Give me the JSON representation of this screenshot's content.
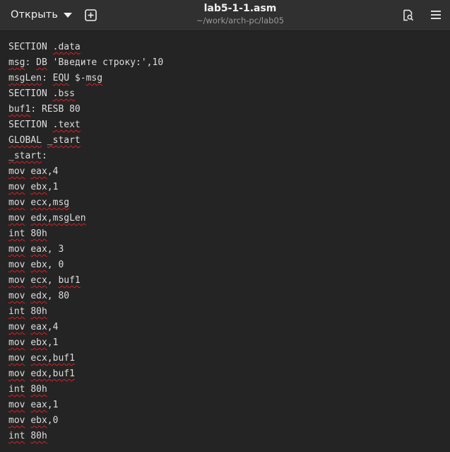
{
  "header": {
    "open_label": "Открыть",
    "title": "lab5-1-1.asm",
    "subtitle": "~/work/arch-pc/lab05"
  },
  "icons": {
    "open_dropdown": "chevron-down-icon",
    "new_tab": "new-tab-icon",
    "search": "document-search-icon",
    "menu": "hamburger-menu-icon"
  },
  "colors": {
    "headerbar": "#303030",
    "editor_bg": "#242424",
    "text": "#dedede",
    "spellcheck_underline": "#e01b24"
  },
  "editor": {
    "lines": [
      [
        {
          "t": "SECTION",
          "s": false
        },
        {
          "t": " ",
          "s": false
        },
        {
          "t": ".data",
          "s": true
        }
      ],
      [
        {
          "t": "msg",
          "s": true
        },
        {
          "t": ": ",
          "s": false
        },
        {
          "t": "DB",
          "s": true
        },
        {
          "t": " 'Введите строку:',10",
          "s": false
        }
      ],
      [
        {
          "t": "msgLen",
          "s": true
        },
        {
          "t": ": ",
          "s": false
        },
        {
          "t": "EQU",
          "s": true
        },
        {
          "t": " $-",
          "s": false
        },
        {
          "t": "msg",
          "s": true
        }
      ],
      [
        {
          "t": "SECTION",
          "s": false
        },
        {
          "t": " ",
          "s": false
        },
        {
          "t": ".bss",
          "s": true
        }
      ],
      [
        {
          "t": "buf1",
          "s": true
        },
        {
          "t": ": ",
          "s": false
        },
        {
          "t": "RESB",
          "s": false
        },
        {
          "t": " 80",
          "s": false
        }
      ],
      [
        {
          "t": "SECTION",
          "s": false
        },
        {
          "t": " ",
          "s": false
        },
        {
          "t": ".text",
          "s": true
        }
      ],
      [
        {
          "t": "GLOBAL",
          "s": true
        },
        {
          "t": " ",
          "s": false
        },
        {
          "t": "_start",
          "s": true
        }
      ],
      [
        {
          "t": "_start",
          "s": true
        },
        {
          "t": ":",
          "s": false
        }
      ],
      [
        {
          "t": "mov",
          "s": true
        },
        {
          "t": " ",
          "s": false
        },
        {
          "t": "eax",
          "s": true
        },
        {
          "t": ",4",
          "s": false
        }
      ],
      [
        {
          "t": "mov",
          "s": true
        },
        {
          "t": " ",
          "s": false
        },
        {
          "t": "ebx",
          "s": true
        },
        {
          "t": ",1",
          "s": false
        }
      ],
      [
        {
          "t": "mov",
          "s": true
        },
        {
          "t": " ",
          "s": false
        },
        {
          "t": "ecx,msg",
          "s": true
        }
      ],
      [
        {
          "t": "mov",
          "s": true
        },
        {
          "t": " ",
          "s": false
        },
        {
          "t": "edx,msgLen",
          "s": true
        }
      ],
      [
        {
          "t": "int",
          "s": true
        },
        {
          "t": " ",
          "s": false
        },
        {
          "t": "80h",
          "s": true
        }
      ],
      [
        {
          "t": "mov",
          "s": true
        },
        {
          "t": " ",
          "s": false
        },
        {
          "t": "eax",
          "s": true
        },
        {
          "t": ", 3",
          "s": false
        }
      ],
      [
        {
          "t": "mov",
          "s": true
        },
        {
          "t": " ",
          "s": false
        },
        {
          "t": "ebx",
          "s": true
        },
        {
          "t": ", 0",
          "s": false
        }
      ],
      [
        {
          "t": "mov",
          "s": true
        },
        {
          "t": " ",
          "s": false
        },
        {
          "t": "ecx",
          "s": true
        },
        {
          "t": ", ",
          "s": false
        },
        {
          "t": "buf1",
          "s": true
        }
      ],
      [
        {
          "t": "mov",
          "s": true
        },
        {
          "t": " ",
          "s": false
        },
        {
          "t": "edx",
          "s": true
        },
        {
          "t": ", 80",
          "s": false
        }
      ],
      [
        {
          "t": "int",
          "s": true
        },
        {
          "t": " ",
          "s": false
        },
        {
          "t": "80h",
          "s": true
        }
      ],
      [
        {
          "t": "mov",
          "s": true
        },
        {
          "t": " ",
          "s": false
        },
        {
          "t": "eax",
          "s": true
        },
        {
          "t": ",4",
          "s": false
        }
      ],
      [
        {
          "t": "mov",
          "s": true
        },
        {
          "t": " ",
          "s": false
        },
        {
          "t": "ebx",
          "s": true
        },
        {
          "t": ",1",
          "s": false
        }
      ],
      [
        {
          "t": "mov",
          "s": true
        },
        {
          "t": " ",
          "s": false
        },
        {
          "t": "ecx,buf1",
          "s": true
        }
      ],
      [
        {
          "t": "mov",
          "s": true
        },
        {
          "t": " ",
          "s": false
        },
        {
          "t": "edx,buf1",
          "s": true
        }
      ],
      [
        {
          "t": "int",
          "s": true
        },
        {
          "t": " ",
          "s": false
        },
        {
          "t": "80h",
          "s": true
        }
      ],
      [
        {
          "t": "mov",
          "s": true
        },
        {
          "t": " ",
          "s": false
        },
        {
          "t": "eax",
          "s": true
        },
        {
          "t": ",1",
          "s": false
        }
      ],
      [
        {
          "t": "mov",
          "s": true
        },
        {
          "t": " ",
          "s": false
        },
        {
          "t": "ebx",
          "s": true
        },
        {
          "t": ",0",
          "s": false
        }
      ],
      [
        {
          "t": "int",
          "s": true
        },
        {
          "t": " ",
          "s": false
        },
        {
          "t": "80h",
          "s": true
        }
      ]
    ]
  }
}
